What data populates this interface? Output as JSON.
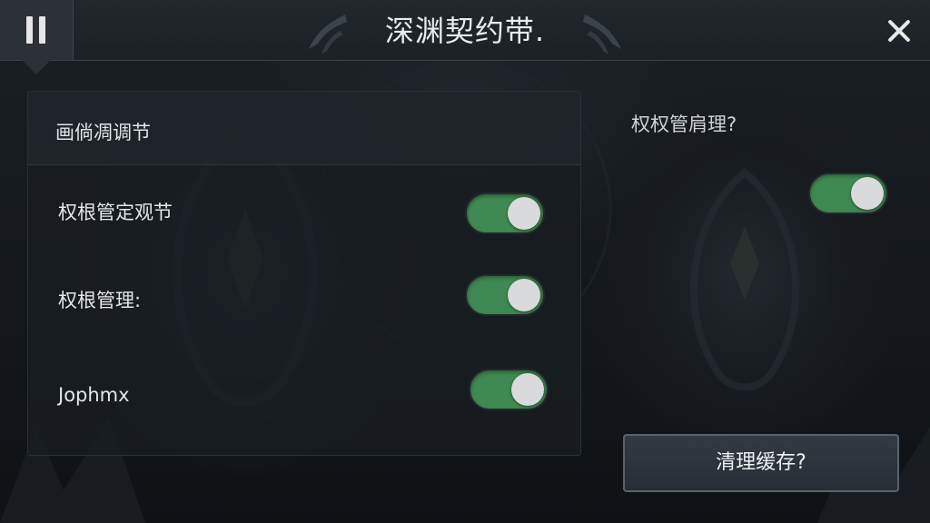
{
  "header": {
    "title": "深渊契约带.",
    "pause_icon": "pause-icon",
    "close_icon": "close-icon"
  },
  "settings_panel": {
    "title": "画倘凋调节",
    "items": [
      {
        "label": "权根管定观节",
        "toggle_on": true
      },
      {
        "label": "权根管理:",
        "toggle_on": true
      },
      {
        "label": "Jophmx",
        "toggle_on": true
      }
    ]
  },
  "right_panel": {
    "title": "权权管肩理?",
    "toggle_on": true
  },
  "clear_cache_button": {
    "label": "清理缓存?"
  },
  "colors": {
    "toggle_on": "#3f8a52",
    "knob": "#d9dadc",
    "text": "#e4e6e8",
    "panel_bg": "#181d22"
  }
}
